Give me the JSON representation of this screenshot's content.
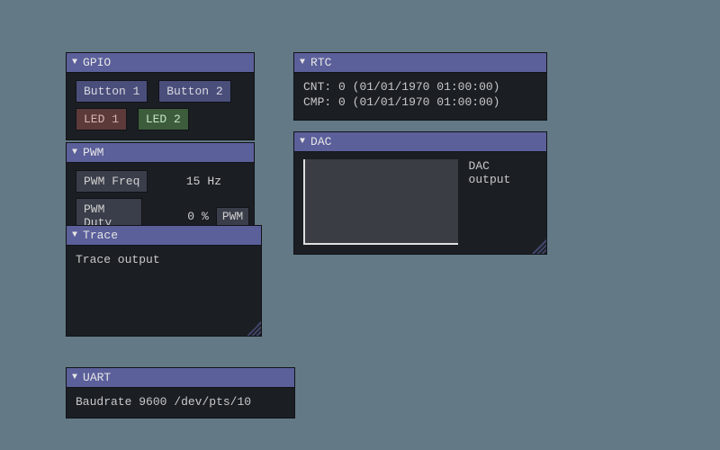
{
  "gpio": {
    "title": "GPIO",
    "buttons": [
      "Button 1",
      "Button 2"
    ],
    "leds": [
      {
        "label": "LED 1",
        "color": "red"
      },
      {
        "label": "LED 2",
        "color": "green"
      }
    ]
  },
  "pwm": {
    "title": "PWM",
    "freq_label": "PWM Freq",
    "freq_value": "15",
    "freq_unit": "Hz",
    "duty_label": "PWM Duty",
    "duty_value": "0",
    "duty_unit": "%",
    "pwm_small_label": "PWM"
  },
  "trace": {
    "title": "Trace",
    "output": "Trace output"
  },
  "uart": {
    "title": "UART",
    "line_label": "Baudrate",
    "baud": "9600",
    "device": "/dev/pts/10"
  },
  "rtc": {
    "title": "RTC",
    "cnt_label": "CNT:",
    "cnt_value": "0",
    "cnt_ts": "(01/01/1970 01:00:00)",
    "cmp_label": "CMP:",
    "cmp_value": "0",
    "cmp_ts": "(01/01/1970 01:00:00)"
  },
  "dac": {
    "title": "DAC",
    "output_label": "DAC output"
  }
}
